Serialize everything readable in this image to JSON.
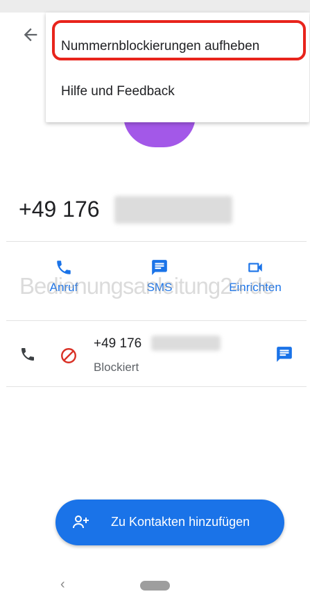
{
  "contact": {
    "number_prefix": "+49 176"
  },
  "menu": {
    "items": [
      {
        "label": "Nummernblockierungen aufheben",
        "icon": "none",
        "highlighted": true
      },
      {
        "label": "Hilfe und Feedback",
        "icon": "none",
        "highlighted": false
      }
    ]
  },
  "actions": [
    {
      "label": "Anruf",
      "icon": "phone-icon"
    },
    {
      "label": "SMS",
      "icon": "message-icon"
    },
    {
      "label": "Einrichten",
      "icon": "video-icon"
    }
  ],
  "watermark": "Bedienungsanleitung24.de",
  "history_row": {
    "number_prefix": "+49 176",
    "status": "Blockiert",
    "icons": [
      "phone-icon",
      "block-icon",
      "message-icon"
    ]
  },
  "fab": {
    "label": "Zu Kontakten hinzufügen",
    "icon": "add-person-icon"
  },
  "navbar": {
    "back_glyph": "‹"
  },
  "colors": {
    "accent": "#1a73e8",
    "avatar": "#a358e8",
    "block": "#d93025",
    "highlight_ring": "#e8241c"
  }
}
